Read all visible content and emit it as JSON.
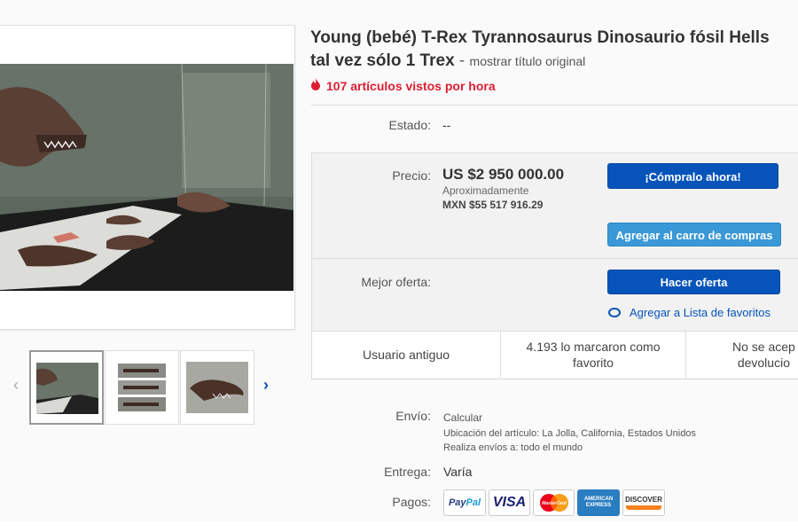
{
  "listing": {
    "title_line1": "Young (bebé) T-Rex Tyrannosaurus Dinosaurio fósil Hells",
    "title_line2": "tal vez sólo 1 Trex",
    "title_sep": " - ",
    "show_original": "mostrar título original",
    "views": "107 artículos vistos por hora",
    "condition_label": "Estado:",
    "condition_value": "--"
  },
  "price": {
    "label": "Precio:",
    "amount": "US $2 950 000.00",
    "approx_label": "Aproximadamente",
    "converted": "MXN $55 517 916.29",
    "buy_now": "¡Cómpralo ahora!",
    "add_to_cart": "Agregar al carro de compras",
    "best_offer_label": "Mejor oferta:",
    "make_offer": "Hacer oferta",
    "watchlist": "Agregar a Lista de favoritos"
  },
  "stats": {
    "seller_status": "Usuario antiguo",
    "watchers_line1": "4.193 lo marcaron como",
    "watchers_line2": "favorito",
    "returns_line1": "No se acep",
    "returns_line2": "devolucio"
  },
  "shipping": {
    "label": "Envío:",
    "calculate": "Calcular",
    "location": "Ubicación del artículo:  La Jolla, California, Estados Unidos",
    "ships_to": "Realiza envíos a:  todo el mundo",
    "delivery_label": "Entrega:",
    "delivery_value": "Varía",
    "payments_label": "Pagos:"
  },
  "payments": {
    "paypal_a": "Pay",
    "paypal_b": "Pal",
    "visa": "VISA",
    "mastercard": "MasterCard",
    "amex_1": "AMERICAN",
    "amex_2": "EXPRESS",
    "discover": "DISCOVER"
  },
  "icons": {
    "flame": "flame-icon",
    "eye": "eye-icon",
    "prev": "chevron-left-icon",
    "next": "chevron-right-icon"
  },
  "colors": {
    "primary_button": "#0654ba",
    "secondary_button": "#3a98d6",
    "views_red": "#dd1e31",
    "link_blue": "#0654ba"
  }
}
